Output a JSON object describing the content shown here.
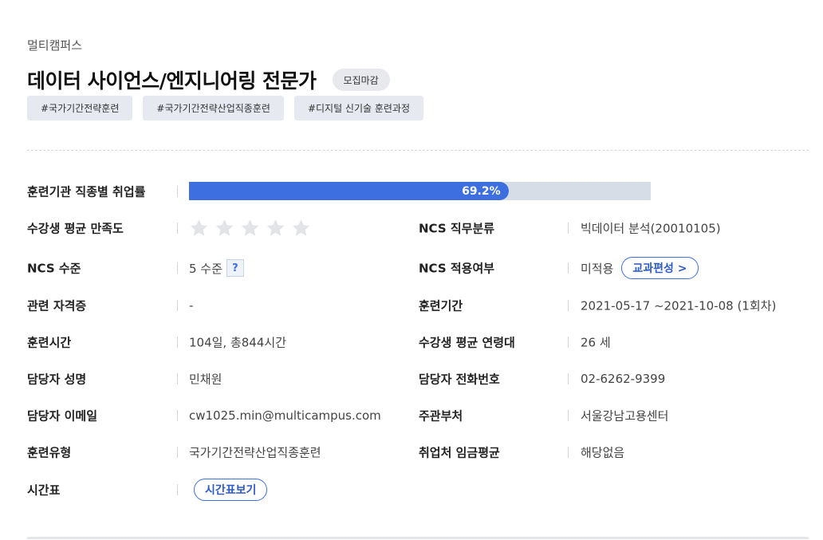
{
  "provider": "멀티캠퍼스",
  "title": "데이터 사이언스/엔지니어링 전문가",
  "status_badge": "모집마감",
  "tags": [
    "#국가기간전략훈련",
    "#국가기간전략산업직종훈련",
    "#디지털 신기술 훈련과정"
  ],
  "employment": {
    "label": "훈련기관 직종별 취업률",
    "rate_text": "69.2%",
    "rate": 69.2
  },
  "satisfaction": {
    "label": "수강생 평균 만족도",
    "stars_filled": 0,
    "stars_total": 5
  },
  "colors": {
    "accent": "#3d6fe0",
    "track": "#d7dde7",
    "star_empty": "#e2e4e8"
  },
  "left": {
    "ncs_level": {
      "label": "NCS 수준",
      "value": "5 수준",
      "help": "?"
    },
    "certificate": {
      "label": "관련 자격증",
      "value": "-"
    },
    "training_time": {
      "label": "훈련시간",
      "value": "104일, 총844시간"
    },
    "manager_name": {
      "label": "담당자 성명",
      "value": "민채원"
    },
    "manager_email": {
      "label": "담당자 이메일",
      "value": "cw1025.min@multicampus.com"
    },
    "training_type": {
      "label": "훈련유형",
      "value": "국가기간전략산업직종훈련"
    },
    "timetable": {
      "label": "시간표",
      "button": "시간표보기"
    }
  },
  "right": {
    "ncs_category": {
      "label": "NCS 직무분류",
      "value": "빅데이터 분석(20010105)"
    },
    "ncs_applied": {
      "label": "NCS 적용여부",
      "value": "미적용",
      "button": "교과편성 >"
    },
    "training_period": {
      "label": "훈련기간",
      "value": "2021-05-17 ~2021-10-08 (1회차)"
    },
    "age_group": {
      "label": "수강생 평균 연령대",
      "value": "26 세"
    },
    "phone": {
      "label": "담당자 전화번호",
      "value": "02-6262-9399"
    },
    "department": {
      "label": "주관부처",
      "value": "서울강남고용센터"
    },
    "salary": {
      "label": "취업처 임금평균",
      "value": "해당없음"
    }
  }
}
